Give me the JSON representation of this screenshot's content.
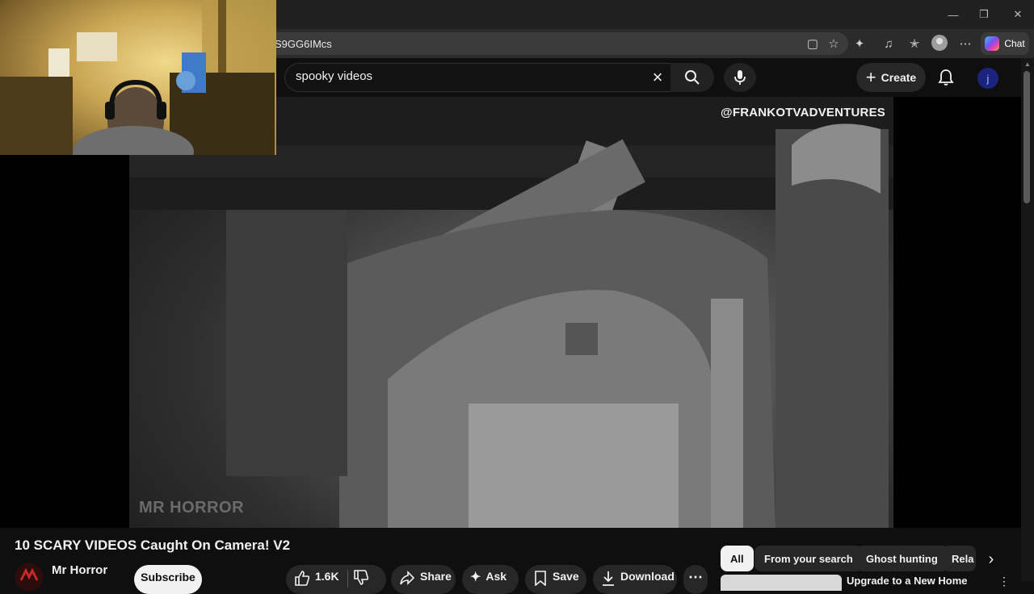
{
  "browser": {
    "address_fragment": "S9GG6IMcs",
    "copilot_label": "Chat",
    "colors": {
      "tabstrip": "#202020",
      "toolbar": "#2b2b2b"
    }
  },
  "youtube": {
    "search": {
      "query": "spooky videos"
    },
    "create_label": "Create",
    "avatar_letter": "j"
  },
  "player": {
    "watermark_handle": "@FRANKOTVADVENTURES",
    "watermark_brand": "MR HORROR"
  },
  "video": {
    "title": "10 SCARY VIDEOS Caught On Camera! V2",
    "channel_name": "Mr Horror",
    "subscribe_label": "Subscribe",
    "actions": {
      "like_count": "1.6K",
      "share_label": "Share",
      "ask_label": "Ask",
      "save_label": "Save",
      "download_label": "Download"
    }
  },
  "chips": [
    "All",
    "From your search",
    "Ghost hunting",
    "Rela"
  ],
  "recommendation": {
    "title": "Upgrade to a New Home"
  },
  "colors": {
    "accent_light": "#f1f1f1",
    "pill_bg": "#272727",
    "page_bg": "#0f0f0f"
  }
}
